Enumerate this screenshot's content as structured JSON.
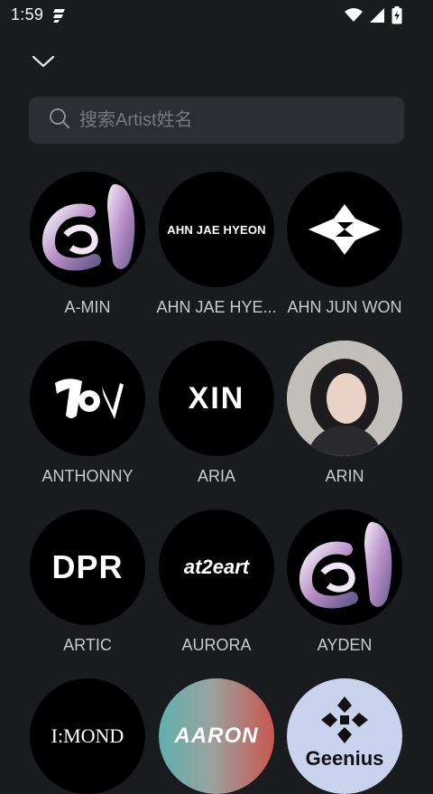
{
  "status_bar": {
    "time": "1:59",
    "icons": [
      "app-notification-icon",
      "wifi-icon",
      "signal-icon",
      "battery-charging-icon"
    ]
  },
  "header": {
    "collapse_icon": "chevron-down-icon"
  },
  "search": {
    "placeholder": "搜索Artist姓名",
    "value": "",
    "icon": "search-icon"
  },
  "artists": [
    {
      "name": "A-MIN"
    },
    {
      "name": "AHN JAE HYE...",
      "logo_text": "AHN JAE HYEON"
    },
    {
      "name": "AHN JUN WON"
    },
    {
      "name": "ANTHONNY"
    },
    {
      "name": "ARIA",
      "logo_text": "XIN"
    },
    {
      "name": "ARIN"
    },
    {
      "name": "ARTIC",
      "logo_text": "DPR"
    },
    {
      "name": "AURORA",
      "logo_text": "at2eart"
    },
    {
      "name": "AYDEN"
    },
    {
      "name": "",
      "logo_text": "I:MOND"
    },
    {
      "name": "",
      "logo_text": "AARON"
    },
    {
      "name": "",
      "logo_text": "Geenius"
    }
  ],
  "colors": {
    "background": "#1a1b1e",
    "search_bg": "#2c2e33",
    "label": "#c9cace"
  }
}
